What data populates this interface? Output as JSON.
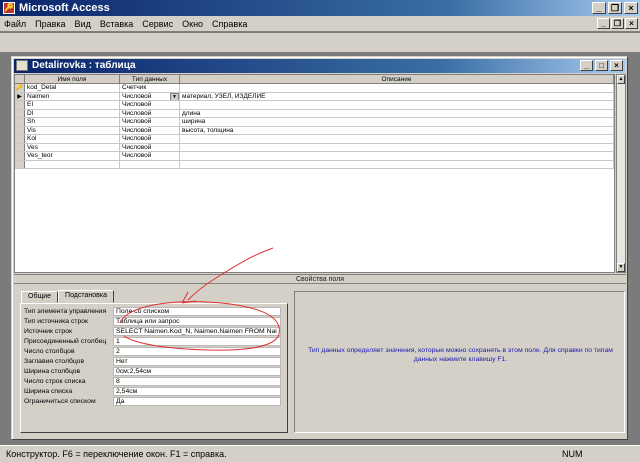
{
  "app": {
    "title": "Microsoft Access"
  },
  "menu": [
    "Файл",
    "Правка",
    "Вид",
    "Вставка",
    "Сервис",
    "Окно",
    "Справка"
  ],
  "window": {
    "title": "Detalirovka : таблица"
  },
  "grid": {
    "headers": {
      "name": "Имя поля",
      "type": "Тип данных",
      "desc": "Описание"
    },
    "rows": [
      {
        "name": "kod_Detal",
        "type": "Счетчик",
        "desc": ""
      },
      {
        "name": "Naimen",
        "type": "Числовой",
        "desc": "материал, УЗЕЛ, ИЗДЕЛИЕ"
      },
      {
        "name": "EI",
        "type": "Числовой",
        "desc": ""
      },
      {
        "name": "Dl",
        "type": "Числовой",
        "desc": "длина"
      },
      {
        "name": "Sh",
        "type": "Числовой",
        "desc": "ширина"
      },
      {
        "name": "Vis",
        "type": "Числовой",
        "desc": "высота, толщина"
      },
      {
        "name": "Kol",
        "type": "Числовой",
        "desc": ""
      },
      {
        "name": "Ves",
        "type": "Числовой",
        "desc": ""
      },
      {
        "name": "Ves_teor",
        "type": "Числовой",
        "desc": ""
      }
    ]
  },
  "props": {
    "section_label": "Свойства поля",
    "tabs": [
      "Общие",
      "Подстановка"
    ],
    "items": [
      {
        "label": "Тип элемента управления",
        "value": "Поле со списком"
      },
      {
        "label": "Тип источника строк",
        "value": "Таблица или запрос"
      },
      {
        "label": "Источник строк",
        "value": "SELECT Naimen.Kod_N, Naimen.Naimen FROM Nai"
      },
      {
        "label": "Присоединенный столбец",
        "value": "1"
      },
      {
        "label": "Число столбцов",
        "value": "2"
      },
      {
        "label": "Заглавия столбцов",
        "value": "Нет"
      },
      {
        "label": "Ширина столбцов",
        "value": "0см;2,54см"
      },
      {
        "label": "Число строк списка",
        "value": "8"
      },
      {
        "label": "Ширина списка",
        "value": "2,54см"
      },
      {
        "label": "Ограничиться списком",
        "value": "Да"
      }
    ],
    "help": "Тип данных определяет значения, которые можно сохранять в этом поле. Для справки по типам данных нажмите клавишу F1."
  },
  "status": {
    "text": "Конструктор. F6 = переключение окон. F1 = справка.",
    "num": "NUM"
  },
  "colors": {
    "title_bar": "#0a246a",
    "annotation": "#e03030",
    "help_text": "#1a1ab0"
  }
}
